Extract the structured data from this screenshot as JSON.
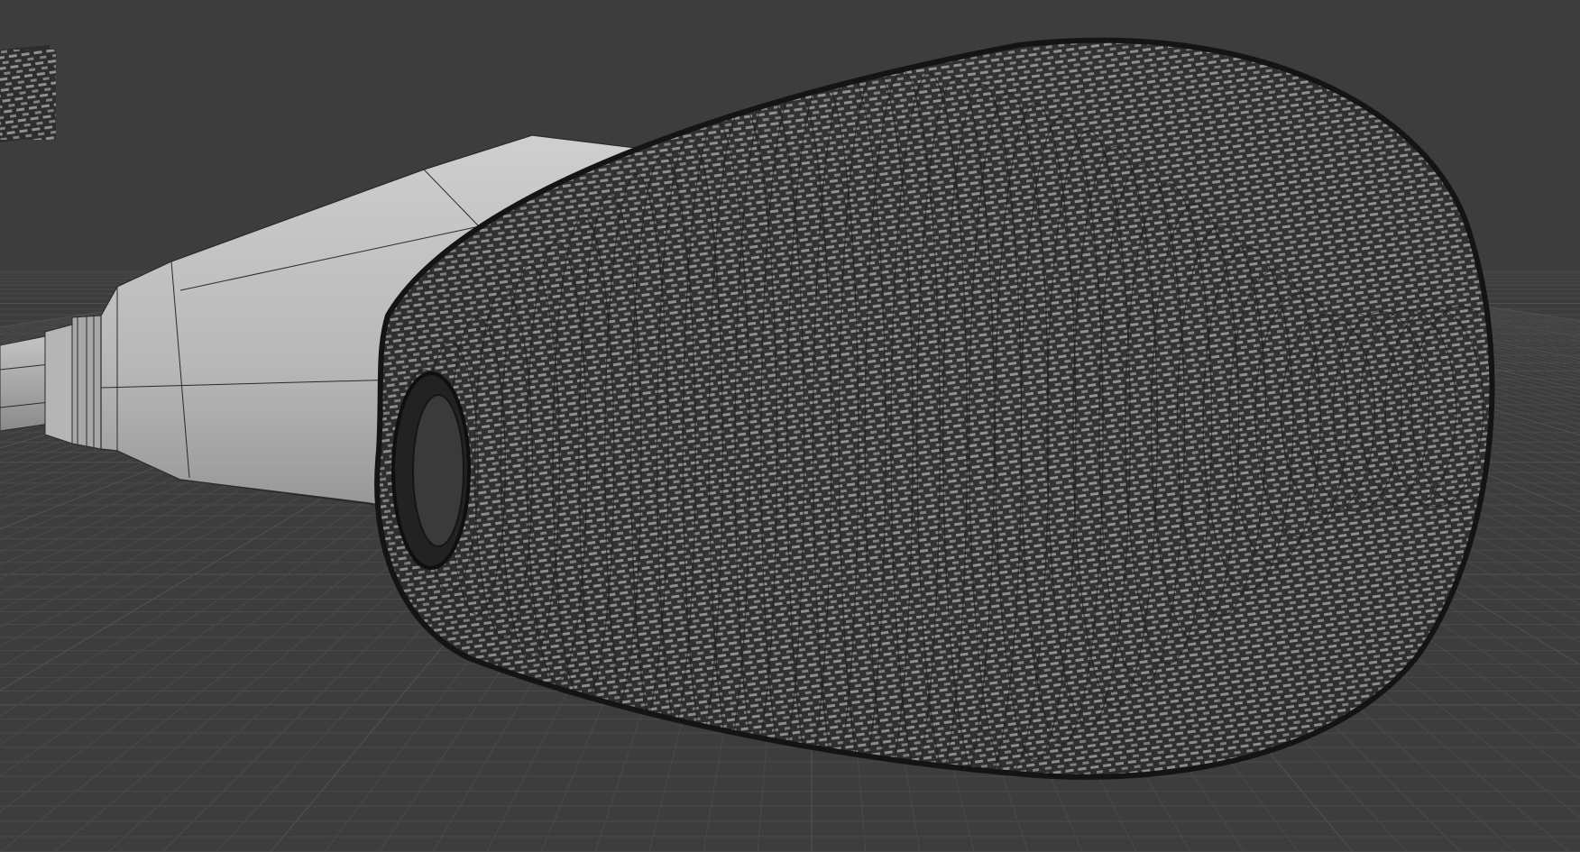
{
  "app": {
    "window": "3d-viewport",
    "shading_mode": "solid-with-wireframe"
  },
  "colors": {
    "background": "#3d3d3d",
    "grid_line": "#4a4a4a",
    "grid_major": "#525252",
    "mesh_light": "#c8c8c8",
    "mesh_mid": "#a6a6a6",
    "mesh_dark": "#7d7d7d",
    "wire_edge": "#2a2a2a",
    "mesh_grille": "#1a1a1a"
  },
  "scene": {
    "objects": [
      {
        "name": "microphone-grille",
        "type": "mesh",
        "visible": true
      },
      {
        "name": "microphone-body",
        "type": "mesh",
        "visible": true
      },
      {
        "name": "microphone-handle",
        "type": "mesh",
        "visible": true
      },
      {
        "name": "mesh-fragment",
        "type": "mesh",
        "visible": true
      }
    ],
    "floor_grid": true
  }
}
